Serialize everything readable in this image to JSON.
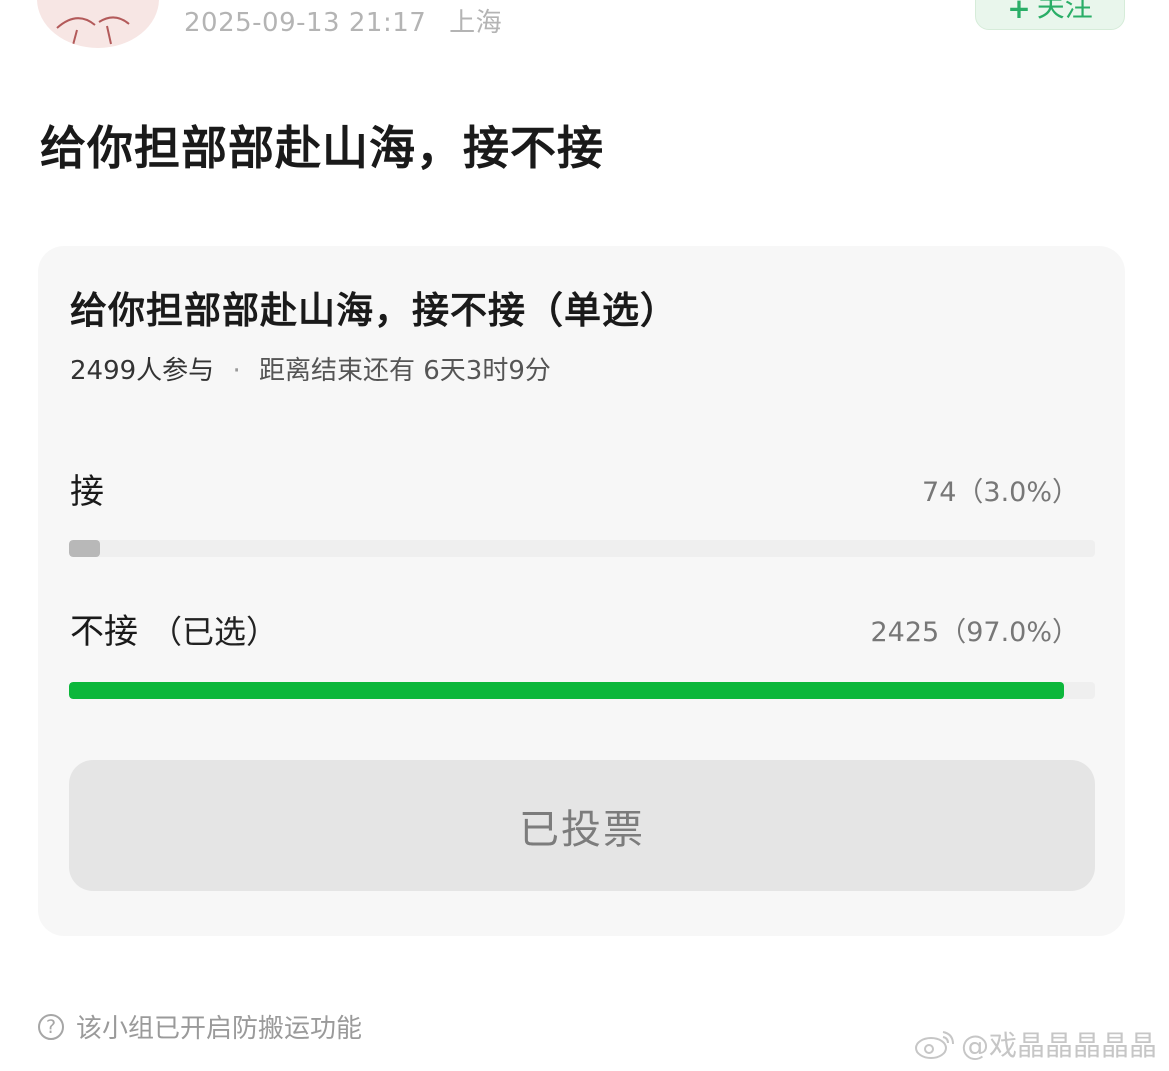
{
  "header": {
    "timestamp": "2025-09-13 21:17",
    "location": "上海",
    "follow_label": "关注",
    "follow_icon": "plus-icon"
  },
  "post": {
    "title": "给你担部部赴山海，接不接"
  },
  "poll": {
    "title": "给你担部部赴山海，接不接（单选）",
    "participants": "2499人参与",
    "separator": "·",
    "countdown": "距离结束还有 6天3时9分",
    "options": [
      {
        "label": "接",
        "selected_tag": "",
        "count": "74（3.0%）",
        "fraction": 0.03,
        "bar_color": "#b8b8b8"
      },
      {
        "label": "不接",
        "selected_tag": "（已选）",
        "count": "2425（97.0%）",
        "fraction": 0.97,
        "bar_color": "#0cb73b"
      }
    ],
    "voted_label": "已投票"
  },
  "footer": {
    "help_icon": "question-circle-icon",
    "note": "该小组已开启防搬运功能"
  },
  "watermark": {
    "icon": "weibo-logo-icon",
    "text": "@戏晶晶晶晶晶"
  },
  "colors": {
    "accent_green": "#0cb73b",
    "follow_green": "#2aae67"
  }
}
